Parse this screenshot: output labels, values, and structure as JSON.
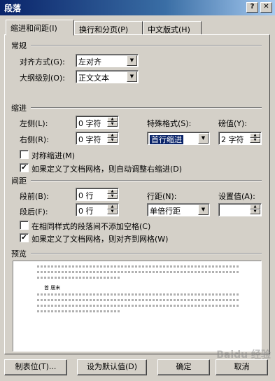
{
  "window": {
    "title": "段落",
    "help": "?",
    "close": "✕"
  },
  "tabs": [
    "缩进和间距(I)",
    "换行和分页(P)",
    "中文版式(H)"
  ],
  "general": {
    "section": "常规",
    "alignment_label": "对齐方式(G):",
    "alignment_value": "左对齐",
    "outline_label": "大纲级别(O):",
    "outline_value": "正文文本"
  },
  "indent": {
    "section": "缩进",
    "left_label": "左侧(L):",
    "left_value": "0 字符",
    "right_label": "右侧(R):",
    "right_value": "0 字符",
    "special_label": "特殊格式(S):",
    "special_value": "首行缩进",
    "by_label": "磅值(Y):",
    "by_value": "2 字符",
    "mirror_label": "对称缩进(M)",
    "mirror_checked": false,
    "grid_label": "如果定义了文档网格，则自动调整右缩进(D)",
    "grid_checked": true
  },
  "spacing": {
    "section": "间距",
    "before_label": "段前(B):",
    "before_value": "0 行",
    "after_label": "段后(F):",
    "after_value": "0 行",
    "line_label": "行距(N):",
    "line_value": "单倍行距",
    "at_label": "设置值(A):",
    "at_value": "",
    "nospace_label": "在相同样式的段落间不添加空格(C)",
    "nospace_checked": false,
    "snap_label": "如果定义了文档网格，则对齐到网格(W)",
    "snap_checked": true
  },
  "preview": {
    "section": "预览",
    "sample": "首 居末"
  },
  "buttons": {
    "tabs": "制表位(T)...",
    "default": "设为默认值(D)",
    "ok": "确定",
    "cancel": "取消"
  },
  "watermark": "Baidu 经验"
}
